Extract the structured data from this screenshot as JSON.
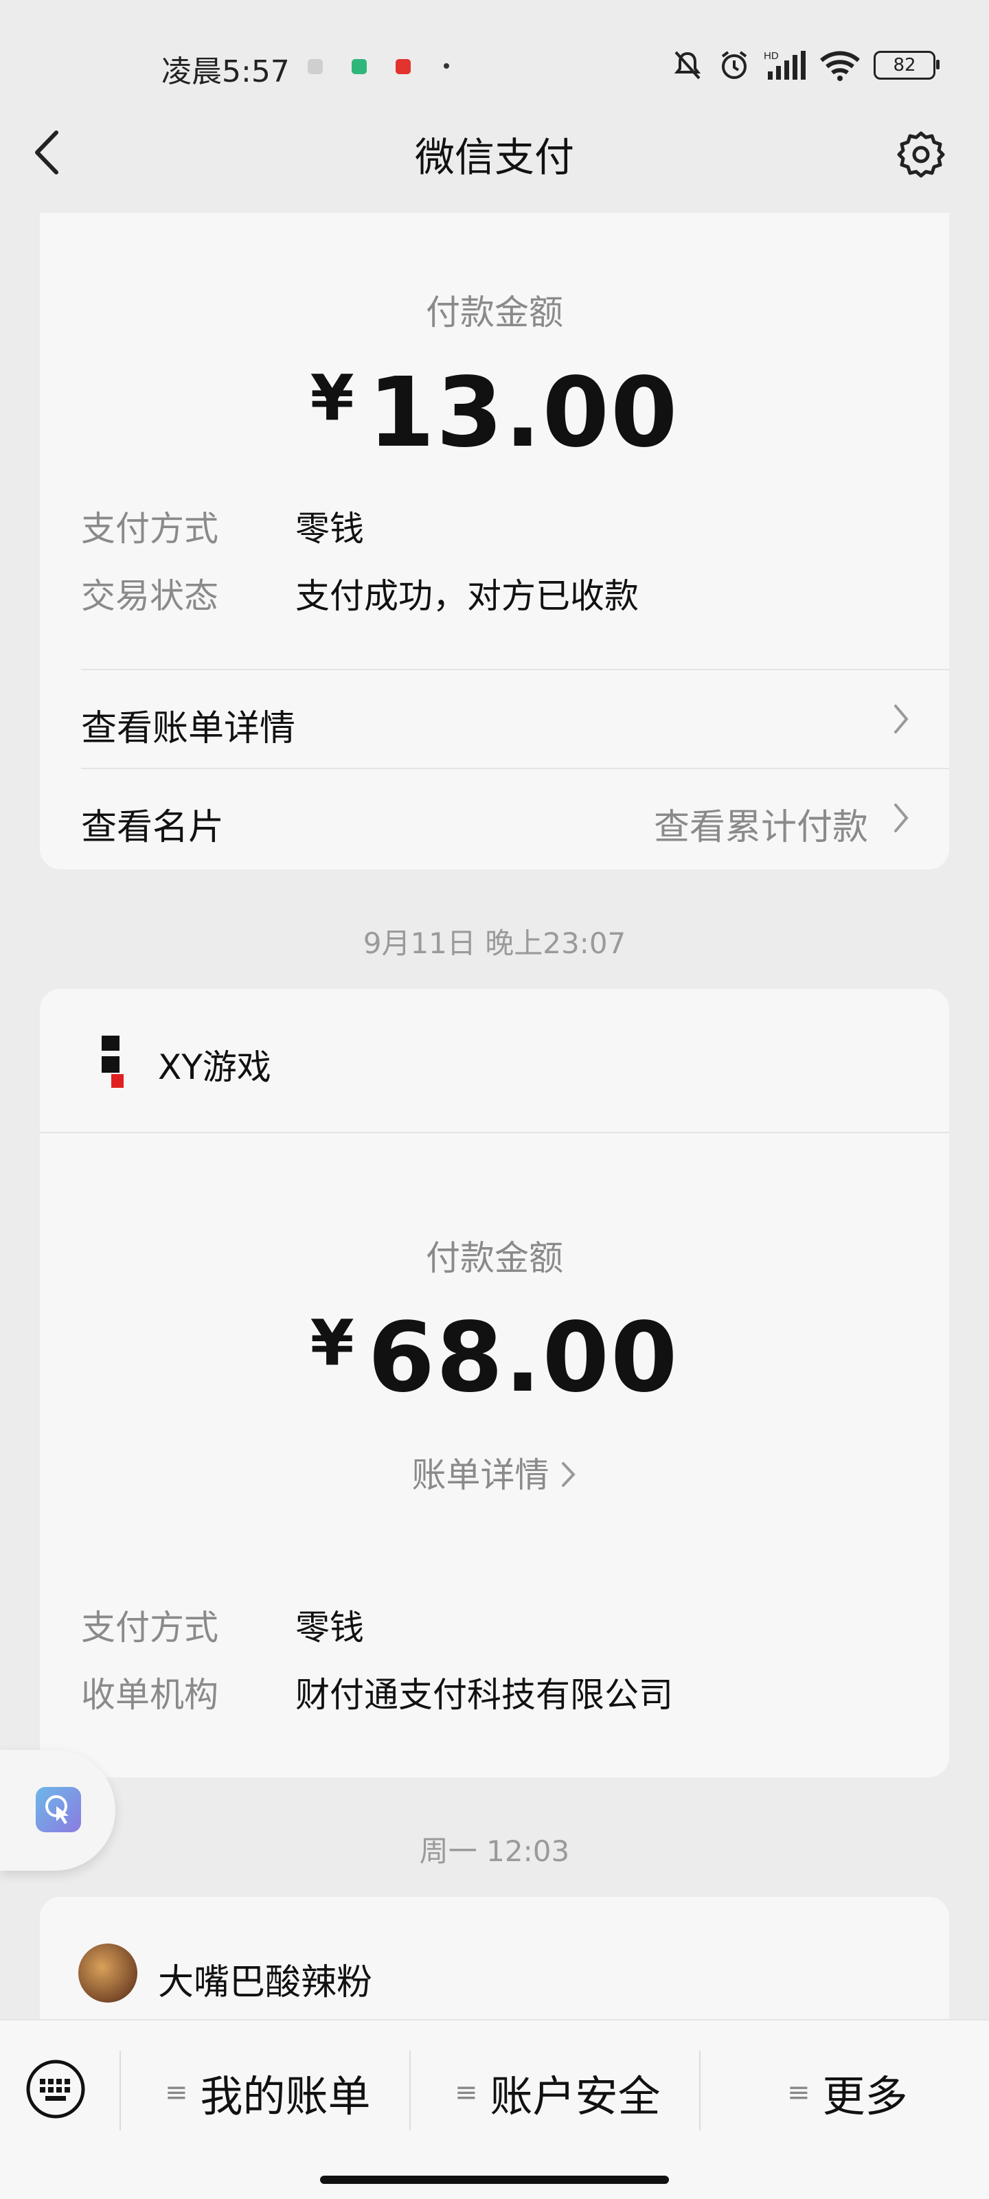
{
  "status_bar": {
    "time": "凌晨5:57",
    "battery": "82"
  },
  "header": {
    "title": "微信支付"
  },
  "card1": {
    "amount_label": "付款金额",
    "currency": "¥",
    "amount": "13.00",
    "details": [
      {
        "label": "支付方式",
        "value": "零钱"
      },
      {
        "label": "交易状态",
        "value": "支付成功，对方已收款"
      }
    ],
    "link_bill": "查看账单详情",
    "link_card": "查看名片",
    "link_cumulative": "查看累计付款"
  },
  "timestamp1": "9月11日 晚上23:07",
  "card2": {
    "merchant": "XY游戏",
    "amount_label": "付款金额",
    "currency": "¥",
    "amount": "68.00",
    "bill_link": "账单详情",
    "details": [
      {
        "label": "支付方式",
        "value": "零钱"
      },
      {
        "label": "收单机构",
        "value": "财付通支付科技有限公司"
      }
    ]
  },
  "timestamp2": "周一 12:03",
  "card3": {
    "merchant": "大嘴巴酸辣粉"
  },
  "bottom_bar": {
    "items": [
      "我的账单",
      "账户安全",
      "更多"
    ]
  },
  "colors": {
    "background": "#ececec",
    "card": "#f7f7f7",
    "grey_text": "#8a8a8a"
  }
}
